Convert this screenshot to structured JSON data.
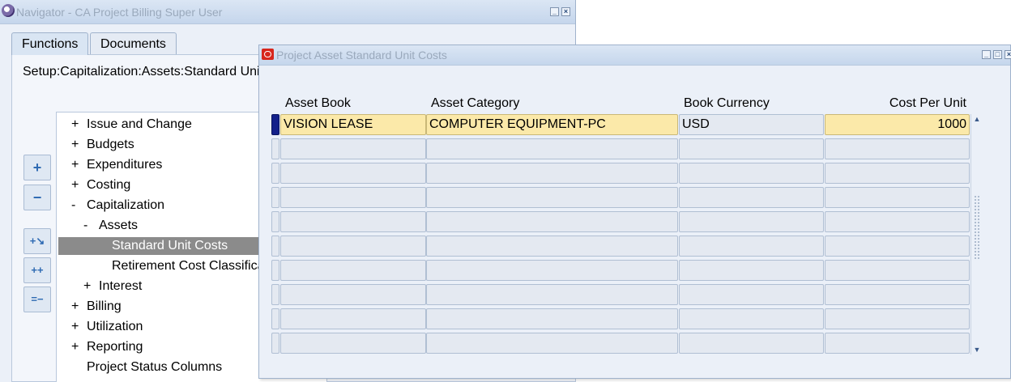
{
  "navigator": {
    "title": "Navigator - CA Project Billing Super User",
    "tabs": [
      {
        "label": "Functions",
        "active": true
      },
      {
        "label": "Documents",
        "active": false
      }
    ],
    "breadcrumb": "Setup:Capitalization:Assets:Standard Unit Costs",
    "side_buttons": [
      "+",
      "−",
      "+↘",
      "++",
      "=−"
    ],
    "tree": [
      {
        "expander": "+",
        "label": "Issue and Change",
        "level": 0
      },
      {
        "expander": "+",
        "label": "Budgets",
        "level": 0
      },
      {
        "expander": "+",
        "label": "Expenditures",
        "level": 0
      },
      {
        "expander": "+",
        "label": "Costing",
        "level": 0
      },
      {
        "expander": "-",
        "label": "Capitalization",
        "level": 0
      },
      {
        "expander": "-",
        "label": "Assets",
        "level": 1
      },
      {
        "expander": "",
        "label": "Standard Unit Costs",
        "level": 2,
        "selected": true
      },
      {
        "expander": "",
        "label": "Retirement Cost Classification",
        "level": 2
      },
      {
        "expander": "+",
        "label": "Interest",
        "level": 1
      },
      {
        "expander": "+",
        "label": "Billing",
        "level": 0
      },
      {
        "expander": "+",
        "label": "Utilization",
        "level": 0
      },
      {
        "expander": "+",
        "label": "Reporting",
        "level": 0
      },
      {
        "expander": "",
        "label": "Project Status Columns",
        "level": 0
      }
    ]
  },
  "pasc": {
    "title": "Project Asset Standard Unit Costs",
    "columns": [
      "Asset Book",
      "Asset Category",
      "Book Currency",
      "Cost Per Unit"
    ],
    "rows": [
      [
        "VISION LEASE",
        "COMPUTER EQUIPMENT-PC",
        "USD",
        "1000"
      ],
      [
        "",
        "",
        "",
        ""
      ],
      [
        "",
        "",
        "",
        ""
      ],
      [
        "",
        "",
        "",
        ""
      ],
      [
        "",
        "",
        "",
        ""
      ],
      [
        "",
        "",
        "",
        ""
      ],
      [
        "",
        "",
        "",
        ""
      ],
      [
        "",
        "",
        "",
        ""
      ],
      [
        "",
        "",
        "",
        ""
      ],
      [
        "",
        "",
        "",
        ""
      ]
    ]
  },
  "colors": {
    "required_field": "#fbe9a9",
    "selected_tree_item": "#8b8b8b",
    "current_record_indicator": "#13208a"
  }
}
